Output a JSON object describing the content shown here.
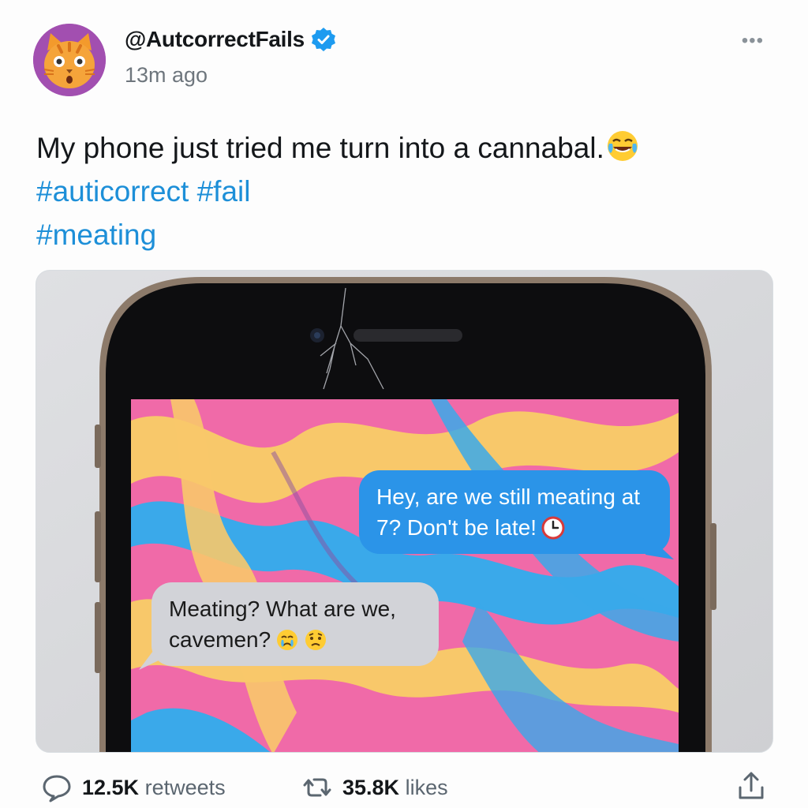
{
  "author": {
    "handle": "@AutcorrectFails",
    "time": "13m ago",
    "avatar_icon": "cat-face-icon",
    "verified_icon": "verified-badge-icon"
  },
  "tweet": {
    "line1": "My phone just tried me turn into a cannabal.",
    "line1_emoji": "face-with-tears-of-joy-icon",
    "hashtags_line2": "#auticorrect #fail",
    "hashtags_line3": "#meating"
  },
  "media": {
    "messages": [
      {
        "side": "sent",
        "text": "Hey, are we still meating at 7? Don't be late!",
        "emoji": "clock-icon"
      },
      {
        "side": "received",
        "text": "Meating? What are we, cavemen?",
        "emoji": [
          "crying-face-icon",
          "worried-face-icon"
        ]
      }
    ]
  },
  "footer": {
    "retweets_count": "12.5K",
    "retweets_label": "retweets",
    "likes_count": "35.8K",
    "likes_label": "likes"
  },
  "colors": {
    "hashtag": "#1d8fd8",
    "sent_bubble": "#2b94e8",
    "received_bubble": "#d2d3d8",
    "avatar_bg": "#a24fb0"
  }
}
